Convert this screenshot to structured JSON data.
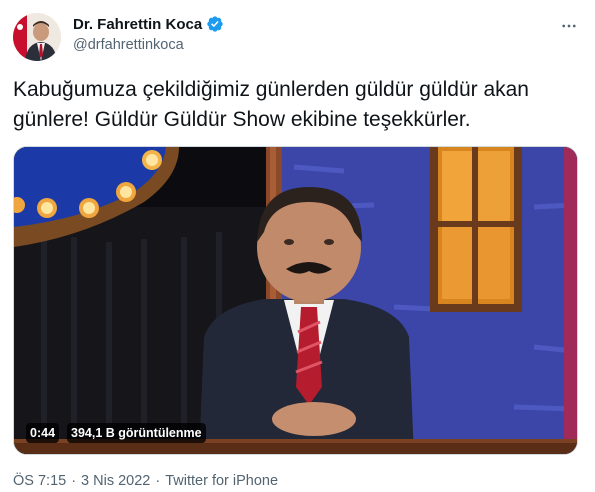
{
  "author": {
    "display_name": "Dr. Fahrettin Koca",
    "handle": "@drfahrettinkoca",
    "verified": true
  },
  "icons": {
    "verified": "verified-badge-icon",
    "more": "more-options-icon"
  },
  "tweet": {
    "text": "Kabuğumuza çekildiğimiz günlerden güldür güldür akan\ngünlere! Güldür Güldür Show ekibine teşekkürler."
  },
  "video": {
    "elapsed": "0:44",
    "views": "394,1 B görüntülenme"
  },
  "meta": {
    "time": "ÖS 7:15",
    "separator1": "·",
    "date": "3 Nis 2022",
    "separator2": "·",
    "source": "Twitter for iPhone"
  },
  "colors": {
    "accent": "#1d9bf0",
    "text": "#0f1419",
    "secondary": "#536471"
  }
}
